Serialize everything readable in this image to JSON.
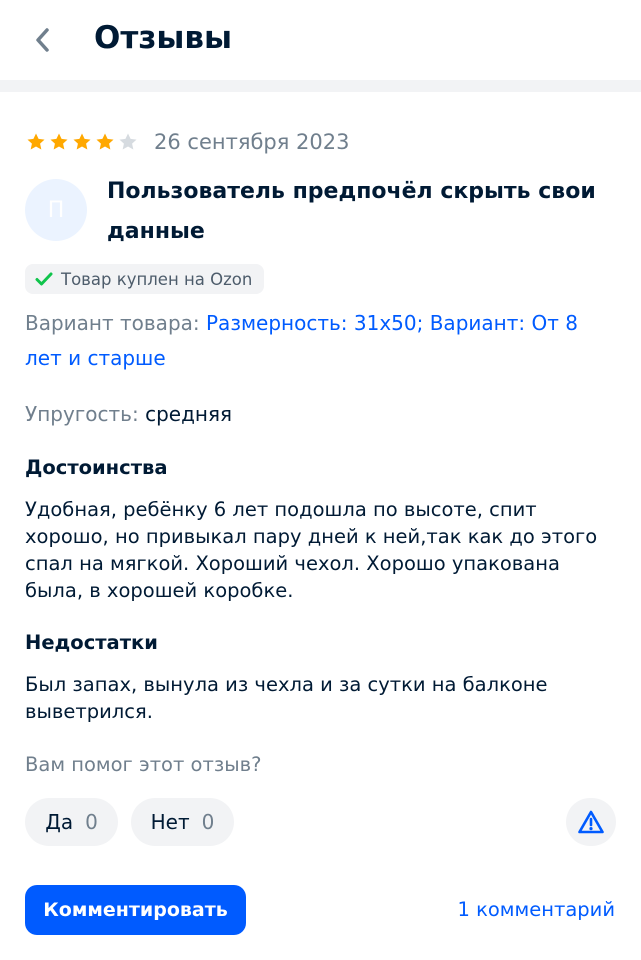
{
  "header": {
    "title": "Отзывы"
  },
  "review": {
    "rating": 4,
    "max_rating": 5,
    "date": "26 сентября 2023",
    "avatar_letter": "П",
    "author": "Пользователь предпочёл скрыть свои данные",
    "bought_badge": "Товар куплен на Ozon",
    "variant_label": "Вариант товара:",
    "variant_value": "Размерность: 31x50; Вариант: От 8 лет и старше",
    "elasticity_label": "Упругость:",
    "elasticity_value": "средняя",
    "pros_title": "Достоинства",
    "pros_text": "Удобная, ребёнку 6 лет подошла по высоте, спит хорошо, но привыкал пару дней к ней,так как до этого спал на мягкой. Хороший чехол. Хорошо упакована была, в хорошей коробке.",
    "cons_title": "Недостатки",
    "cons_text": "Был запах, вынула из чехла и за сутки на балконе выветрился."
  },
  "helpful": {
    "question": "Вам помог этот отзыв?",
    "yes_label": "Да",
    "yes_count": "0",
    "no_label": "Нет",
    "no_count": "0"
  },
  "actions": {
    "comment_button": "Комментировать",
    "comments_link": "1 комментарий"
  },
  "icons": {
    "back": "chevron-left-icon",
    "star": "star-icon",
    "check": "check-icon",
    "report": "warning-triangle-icon"
  },
  "colors": {
    "accent": "#005bff",
    "star_filled": "#ffa800",
    "star_empty": "#d6dbe0",
    "check": "#10c44c",
    "text_primary": "#001a34",
    "text_secondary": "#707f8d"
  }
}
